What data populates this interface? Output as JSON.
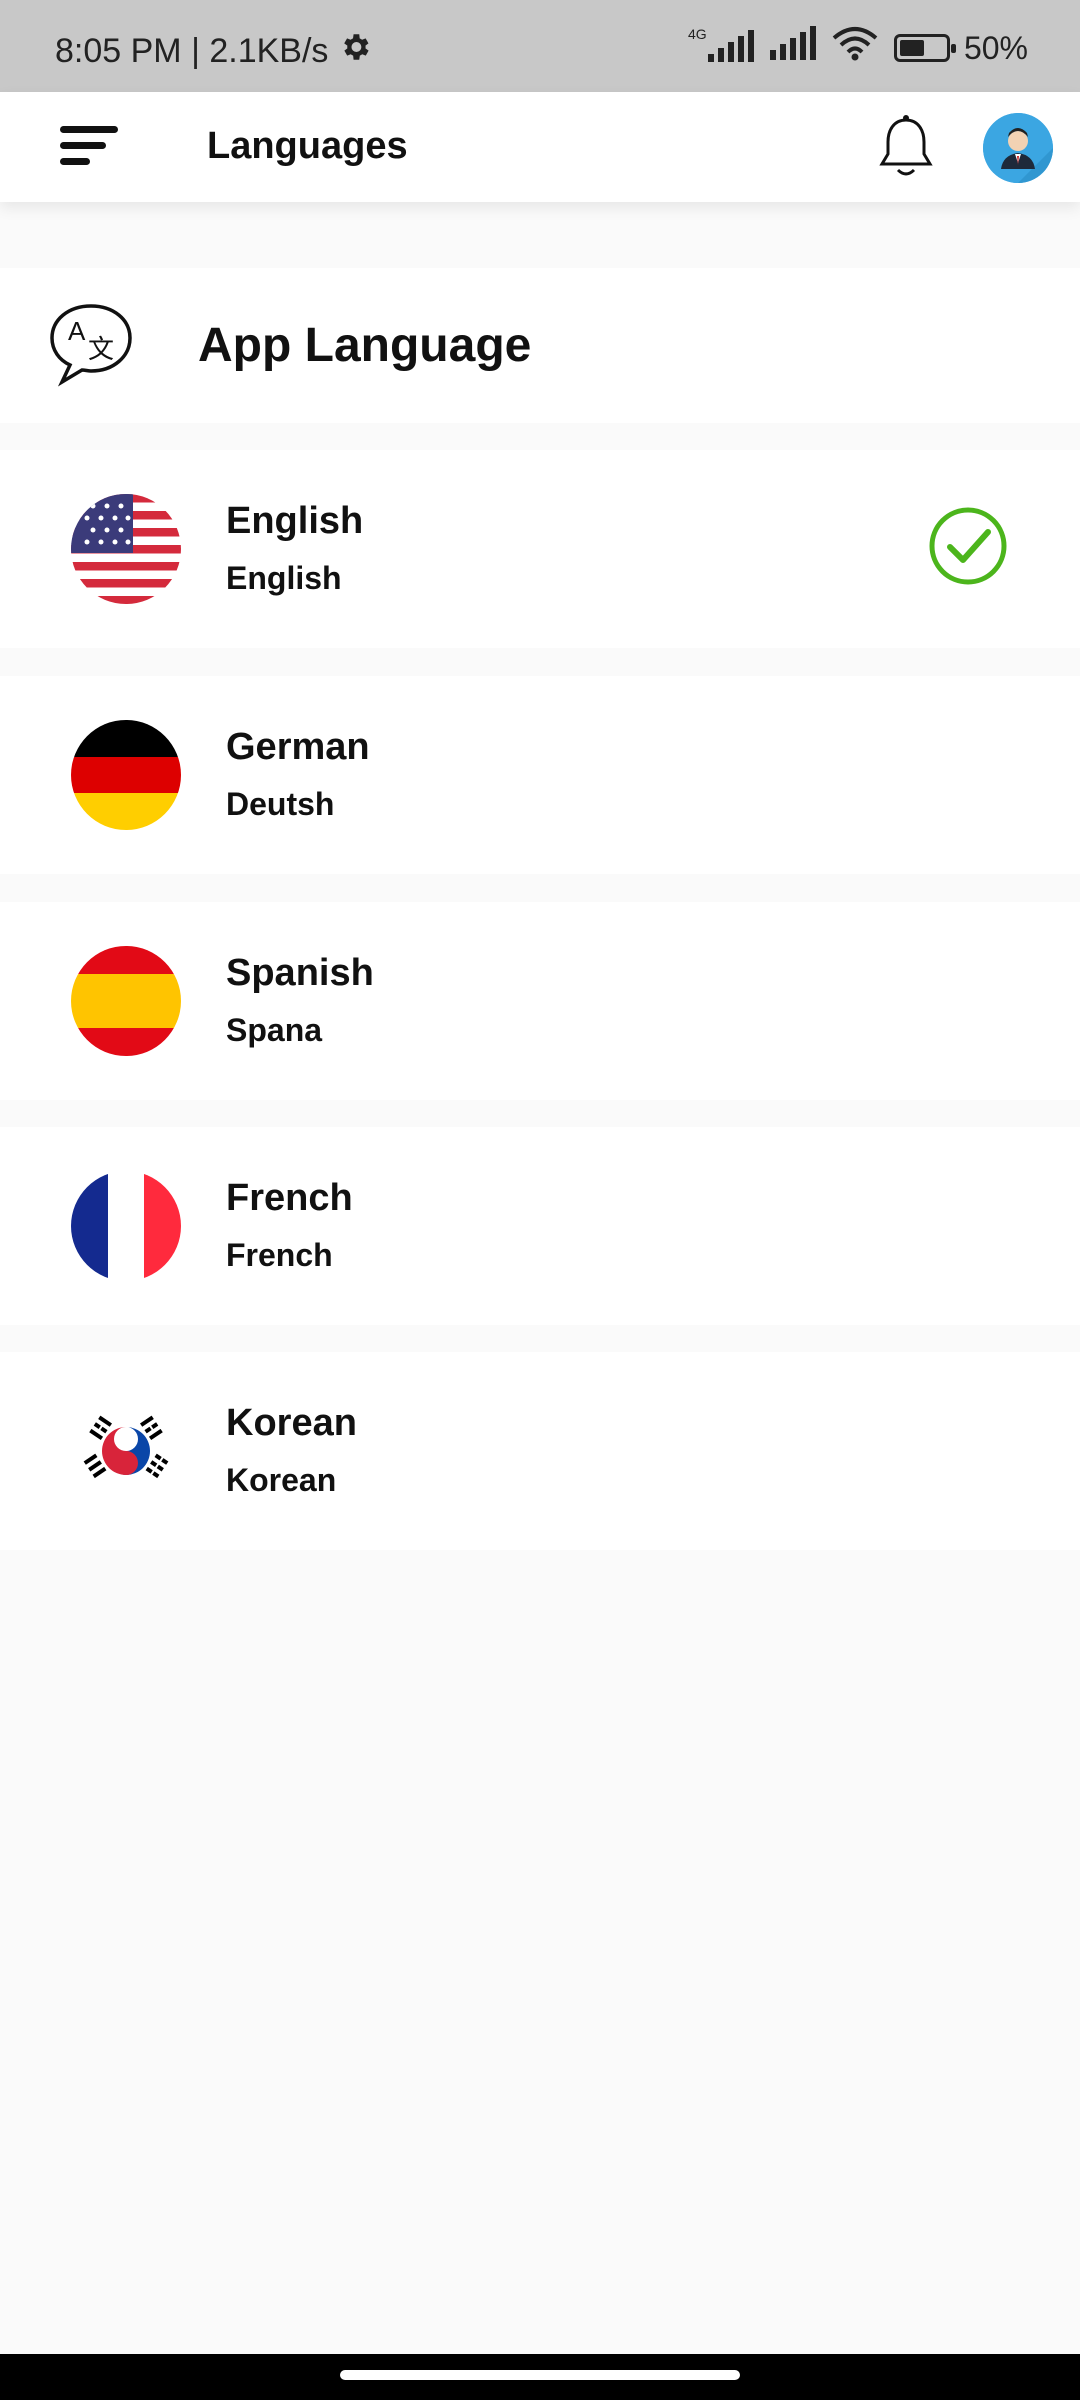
{
  "status_bar": {
    "time_speed": "8:05 PM | 2.1KB/s",
    "network_label": "4G",
    "battery_text": "50%",
    "battery_level": 0.5,
    "icons": [
      "gear-icon",
      "cellular-signal-icon",
      "wifi-icon",
      "battery-icon"
    ]
  },
  "app_bar": {
    "title": "Languages",
    "icons": [
      "menu-icon",
      "bell-icon",
      "avatar-icon"
    ]
  },
  "section": {
    "title": "App Language",
    "icon": "translate-icon"
  },
  "languages": [
    {
      "name": "English",
      "native": "English",
      "flag": "us-flag",
      "selected": true
    },
    {
      "name": "German",
      "native": "Deutsh",
      "flag": "german-flag",
      "selected": false
    },
    {
      "name": "Spanish",
      "native": "Spana",
      "flag": "spanish-flag",
      "selected": false
    },
    {
      "name": "French",
      "native": "French",
      "flag": "french-flag",
      "selected": false
    },
    {
      "name": "Korean",
      "native": "Korean",
      "flag": "korean-flag",
      "selected": false
    }
  ],
  "colors": {
    "accent_check": "#4cb51c",
    "status_bar_bg": "#c8c8c8",
    "avatar_bg": "#3ba6e2",
    "page_bg": "#fafafa"
  }
}
